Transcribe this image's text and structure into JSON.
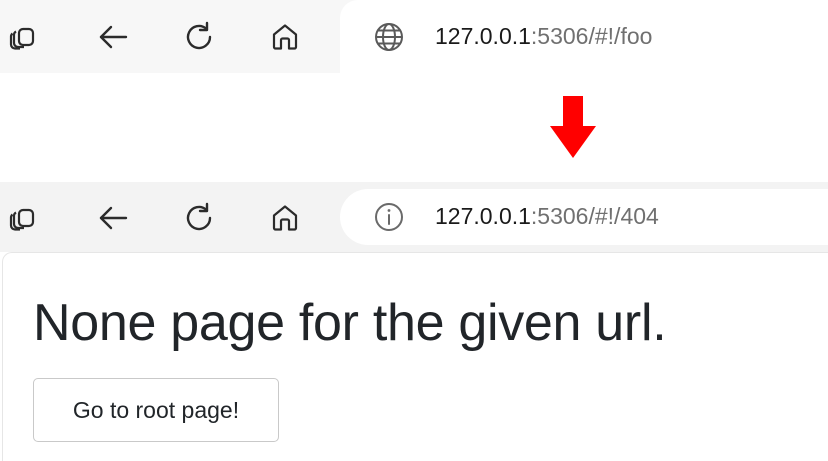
{
  "before": {
    "toolbar": {
      "tabs_icon": "tab-actions-icon",
      "back_icon": "back-arrow-icon",
      "reload_icon": "reload-icon",
      "home_icon": "home-icon"
    },
    "address_bar": {
      "icon": "globe-icon",
      "url_host": "127.0.0.1",
      "url_rest": ":5306/#!/foo"
    }
  },
  "transition": {
    "icon": "arrow-down-icon",
    "color": "#ff0000"
  },
  "after": {
    "toolbar": {
      "tabs_icon": "tab-actions-icon",
      "back_icon": "back-arrow-icon",
      "reload_icon": "reload-icon",
      "home_icon": "home-icon"
    },
    "address_bar": {
      "icon": "info-icon",
      "url_host": "127.0.0.1",
      "url_rest": ":5306/#!/404"
    },
    "page": {
      "heading": "None page for the given url.",
      "button_label": "Go to root page!"
    }
  }
}
